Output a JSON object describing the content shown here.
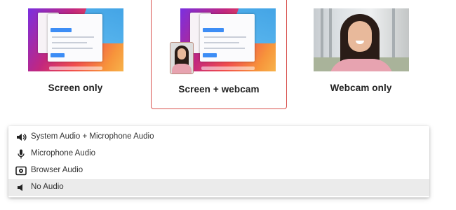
{
  "modes": [
    {
      "label": "Screen only",
      "selected": false
    },
    {
      "label": "Screen + webcam",
      "selected": true
    },
    {
      "label": "Webcam only",
      "selected": false
    }
  ],
  "audio_menu": {
    "items": [
      {
        "label": "System Audio + Microphone Audio",
        "icon": "speaker-loud-icon",
        "selected": false
      },
      {
        "label": "Microphone Audio",
        "icon": "microphone-icon",
        "selected": false
      },
      {
        "label": "Browser Audio",
        "icon": "browser-audio-icon",
        "selected": false
      },
      {
        "label": "No Audio",
        "icon": "speaker-icon",
        "selected": true
      }
    ]
  },
  "colors": {
    "selected_border": "#d9534f",
    "menu_selected_bg": "#ebebeb"
  }
}
